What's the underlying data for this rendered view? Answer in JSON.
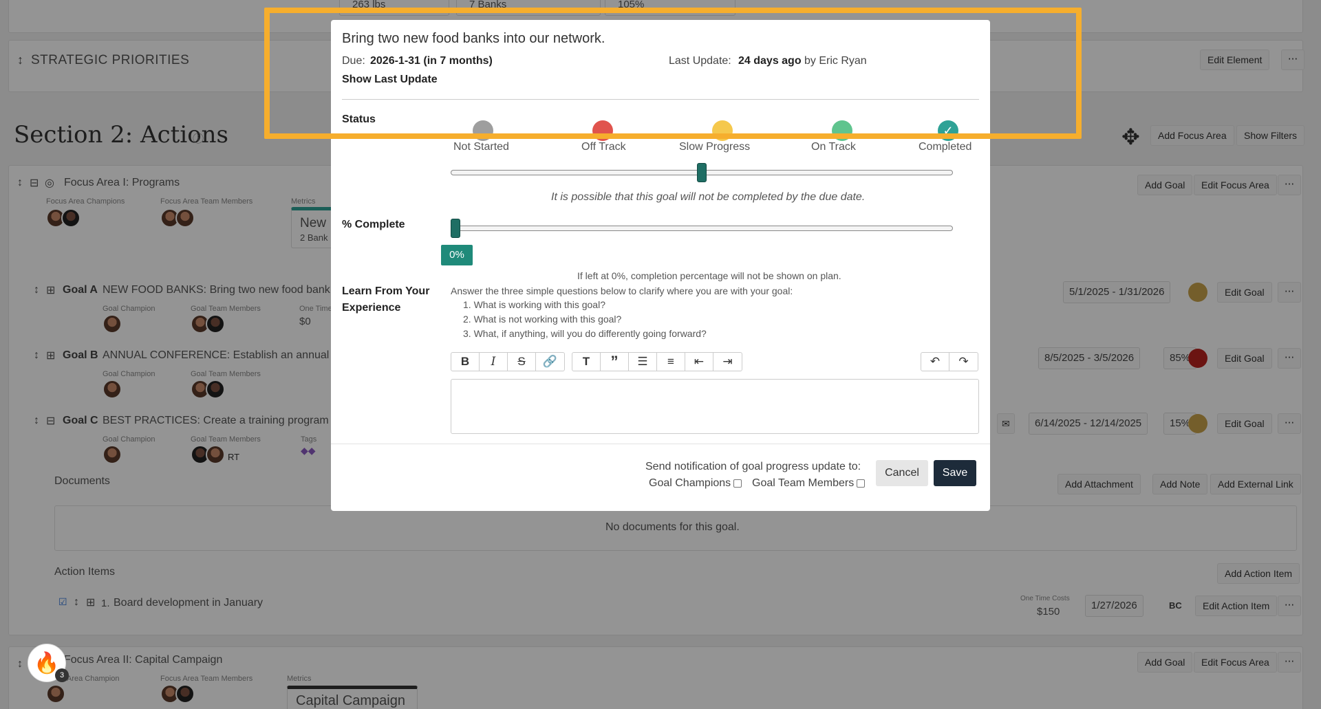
{
  "background": {
    "top_metrics": [
      "263 lbs",
      "7 Banks",
      "105%"
    ],
    "strategic_priorities": {
      "title": "STRATEGIC PRIORITIES",
      "edit_button": "Edit Element",
      "more": "···"
    },
    "section": {
      "title": "Section 2: Actions",
      "info_icon": "info-icon",
      "add_focus_area": "Add Focus Area",
      "show_filters": "Show Filters"
    },
    "focus_area_1": {
      "title": "Focus Area I: Programs",
      "champions_label": "Focus Area Champions",
      "team_label": "Focus Area Team Members",
      "metrics_label": "Metrics",
      "metric_title": "New",
      "metric_sub": "2 Bank",
      "add_goal": "Add Goal",
      "edit_focus_area": "Edit Focus Area",
      "more": "···"
    },
    "goals": [
      {
        "label": "Goal A",
        "text": "NEW FOOD BANKS: Bring two new food bank",
        "champion_label": "Goal Champion",
        "team_label": "Goal Team Members",
        "extra_label": "One Time",
        "extra_value": "$0",
        "dates": "5/1/2025 - 1/31/2026",
        "percent": "",
        "status_color": "#c9a24a",
        "edit": "Edit Goal",
        "more": "···"
      },
      {
        "label": "Goal B",
        "text": "ANNUAL CONFERENCE: Establish an annual",
        "champion_label": "Goal Champion",
        "team_label": "Goal Team Members",
        "extra_label": "",
        "extra_value": "",
        "dates": "8/5/2025 - 3/5/2026",
        "percent": "85%",
        "status_color": "#b8231f",
        "edit": "Edit Goal",
        "more": "···"
      },
      {
        "label": "Goal C",
        "text": "BEST PRACTICES: Create a training program",
        "champion_label": "Goal Champion",
        "team_label": "Goal Team Members",
        "extra_label": "Tags",
        "extra_value": "",
        "dates": "6/14/2025 - 12/14/2025",
        "percent": "15%",
        "status_color": "#c9a24a",
        "edit": "Edit Goal",
        "more": "···"
      }
    ],
    "goal_c_team_initials": "RT",
    "documents": {
      "label": "Documents",
      "empty": "No documents for this goal.",
      "add_attachment": "Add Attachment",
      "add_note": "Add Note",
      "add_external_link": "Add External Link"
    },
    "action_items": {
      "label": "Action Items",
      "add": "Add Action Item",
      "item_number": "1.",
      "item_text": "Board development in January",
      "cost_label": "One Time Costs",
      "cost_value": "$150",
      "date": "1/27/2026",
      "initials": "BC",
      "edit": "Edit Action Item",
      "more": "···"
    },
    "focus_area_2": {
      "title": "Focus Area II: Capital Campaign",
      "champion_label": "Area Champion",
      "team_label": "Focus Area Team Members",
      "metrics_label": "Metrics",
      "metric_title": "Capital Campaign",
      "add_goal": "Add Goal",
      "edit_focus_area": "Edit Focus Area",
      "more": "···"
    },
    "notification_count": "3"
  },
  "modal": {
    "title": "Bring two new food banks into our network.",
    "due_label": "Due:",
    "due_value": "2026-1-31 (in 7 months)",
    "last_update_label": "Last Update:",
    "last_update_value": "24 days ago",
    "last_update_by": "by Eric Ryan",
    "show_last_update": "Show Last Update",
    "status_label": "Status",
    "statuses": [
      {
        "label": "Not Started",
        "color": "#9e9e9e"
      },
      {
        "label": "Off Track",
        "color": "#e0544d"
      },
      {
        "label": "Slow Progress",
        "color": "#f5c84c"
      },
      {
        "label": "On Track",
        "color": "#5fc48e"
      },
      {
        "label": "Completed",
        "color": "#2fa296"
      }
    ],
    "status_value": 0.5,
    "status_note": "It is possible that this goal will not be completed by the due date.",
    "percent_label": "% Complete",
    "percent_value": "0%",
    "percent_note": "If left at 0%, completion percentage will not be shown on plan.",
    "learn_label_1": "Learn From Your",
    "learn_label_2": "Experience",
    "learn_intro": "Answer the three simple questions below to clarify where you are with your goal:",
    "questions": [
      "1. What is working with this goal?",
      "2. What is not working with this goal?",
      "3. What, if anything, will you do differently going forward?"
    ],
    "toolbar_icons": [
      "bold-icon",
      "italic-icon",
      "strikethrough-icon",
      "link-icon",
      "heading-icon",
      "quote-icon",
      "bullet-list-icon",
      "numbered-list-icon",
      "outdent-icon",
      "indent-icon",
      "undo-icon",
      "redo-icon"
    ],
    "notify_label": "Send notification of goal progress update to:",
    "notify_champions": "Goal Champions",
    "notify_team": "Goal Team Members",
    "cancel": "Cancel",
    "save": "Save"
  },
  "highlight_color": "#f6ae2d"
}
